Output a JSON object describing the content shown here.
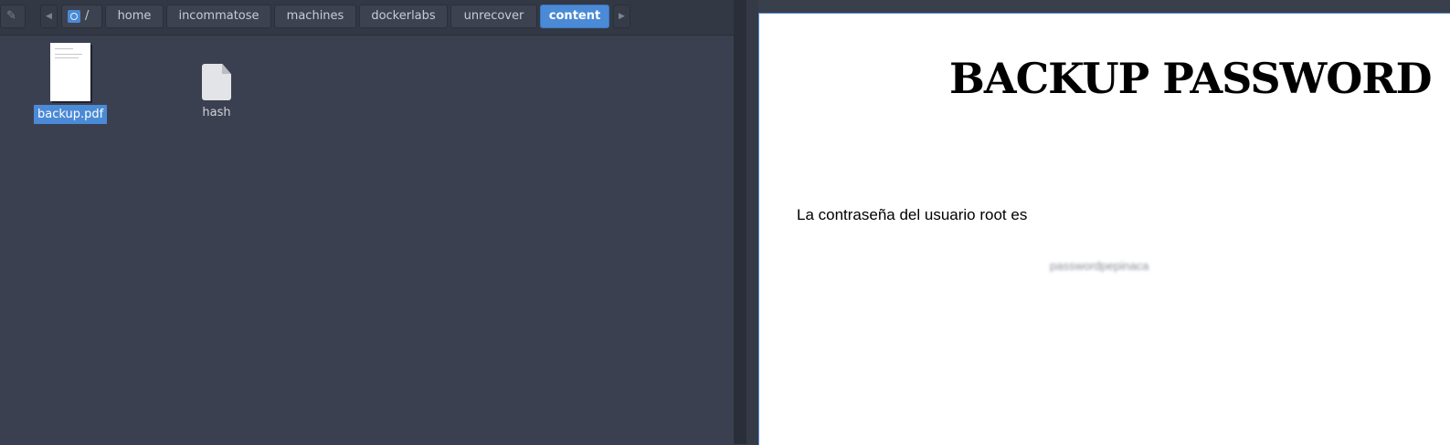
{
  "file_manager": {
    "path_buttons": [
      {
        "label": "/",
        "active": false
      },
      {
        "label": "home",
        "active": false
      },
      {
        "label": "incommatose",
        "active": false
      },
      {
        "label": "machines",
        "active": false
      },
      {
        "label": "dockerlabs",
        "active": false
      },
      {
        "label": "unrecover",
        "active": false
      },
      {
        "label": "content",
        "active": true
      }
    ],
    "nav_left_icon": "chevron-left-icon",
    "nav_right_icon": "chevron-right-icon",
    "files": [
      {
        "name": "backup.pdf",
        "type": "pdf",
        "selected": true
      },
      {
        "name": "hash",
        "type": "file",
        "selected": false
      }
    ]
  },
  "pdf_viewer": {
    "title": "BACKUP PASSWORD",
    "body": "La contraseña del usuario root es",
    "password": "passwordpepinaca"
  },
  "colors": {
    "accent": "#4a8ad6",
    "pane_bg": "#3b4050",
    "toolbar_bg": "#333845"
  }
}
